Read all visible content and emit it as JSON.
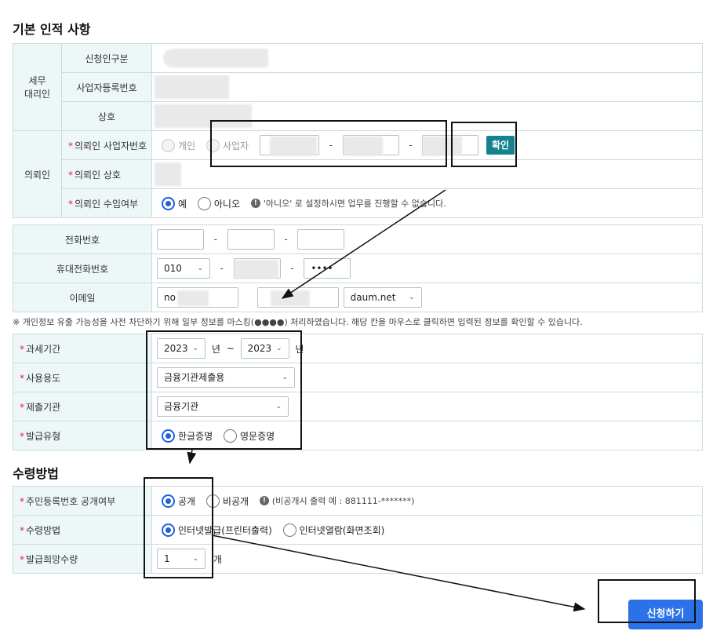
{
  "sections": {
    "basic_title": "기본 인적 사항",
    "receive_title": "수령방법"
  },
  "agent": {
    "group_label_line1": "세무",
    "group_label_line2": "대리인",
    "type_label": "신청인구분",
    "bizno_label": "사업자등록번호",
    "name_label": "상호"
  },
  "delegate": {
    "group_label": "의뢰인",
    "bizno_label": "의뢰인 사업자번호",
    "opt_individual": "개인",
    "opt_business": "사업자",
    "confirm_button": "확인",
    "name_label": "의뢰인 상호",
    "accept_label": "의뢰인 수임여부",
    "accept_yes": "예",
    "accept_no": "아니오",
    "accept_note": "'아니오' 로 설정하시면 업무를 진행할 수 없습니다."
  },
  "contact": {
    "phone_label": "전화번호",
    "mobile_label": "휴대전화번호",
    "mobile_prefix": "010",
    "mobile_last": "••••",
    "email_label": "이메일",
    "email_prefix": "no",
    "email_domain": "daum.net",
    "dash": "-"
  },
  "notice": "※ 개인정보 유출 가능성을 사전 차단하기 위해 일부 정보를 마스킹(●●●●) 처리하였습니다. 해당 칸을 마우스로 클릭하면 입력된 정보를 확인할 수 있습니다.",
  "request": {
    "period_label": "과세기간",
    "year_from": "2023",
    "year_to": "2023",
    "year_unit": "년",
    "tilde": "~",
    "purpose_label": "사용용도",
    "purpose_value": "금융기관제출용",
    "org_label": "제출기관",
    "org_value": "금융기관",
    "type_label": "발급유형",
    "type_korean": "한글증명",
    "type_english": "영문증명"
  },
  "receive": {
    "ssn_label": "주민등록번호 공개여부",
    "ssn_public": "공개",
    "ssn_private": "비공개",
    "ssn_note": "(비공개시 출력 예 : 881111-*******)",
    "method_label": "수령방법",
    "method_print": "인터넷발급(프린터출력)",
    "method_view": "인터넷열람(화면조회)",
    "qty_label": "발급희망수량",
    "qty_value": "1",
    "qty_unit": "개"
  },
  "apply_button": "신청하기",
  "icons": {
    "required": "asterisk-icon",
    "info": "info-circle-icon",
    "dropdown": "chevron-down-icon"
  },
  "colors": {
    "accent_blue": "#2b72e8",
    "confirm_teal": "#15838f",
    "required_red": "#e0203a",
    "header_bg": "#eef7f7",
    "border": "#c8dcdc"
  }
}
